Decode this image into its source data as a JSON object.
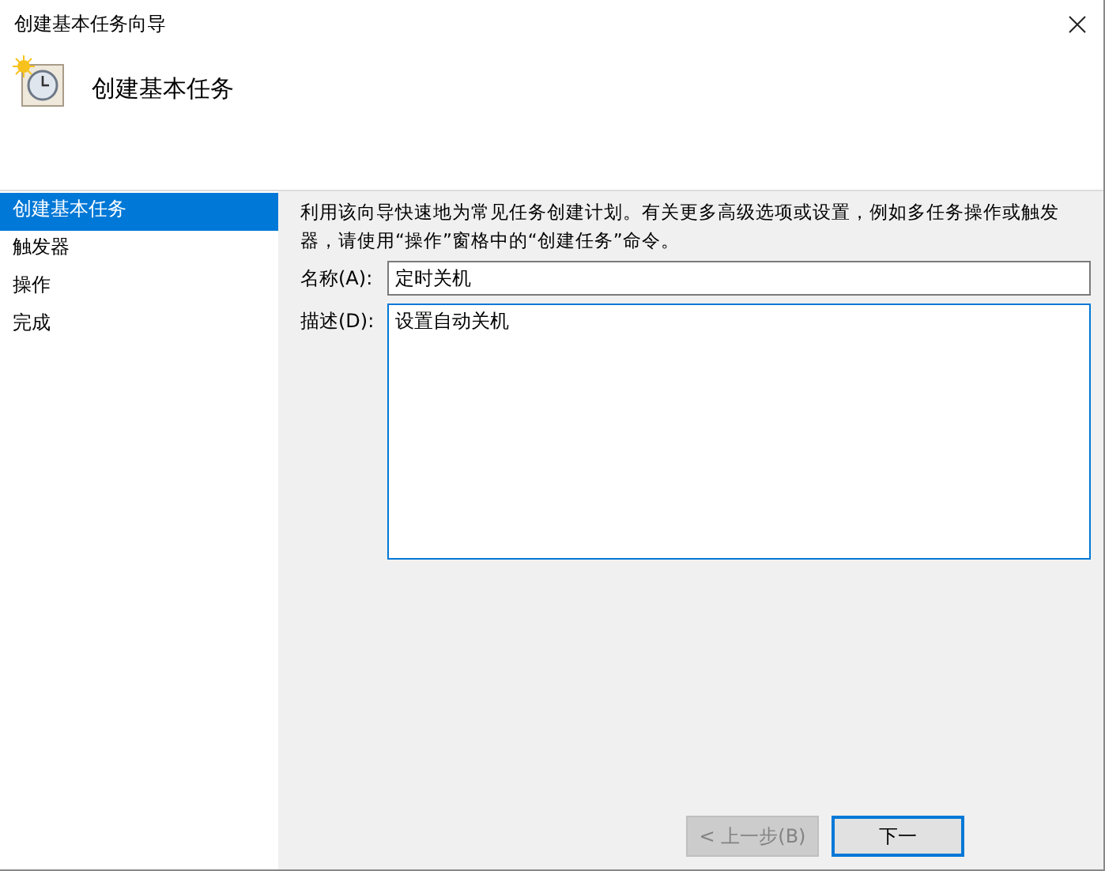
{
  "window": {
    "title": "创建基本任务向导"
  },
  "header": {
    "title": "创建基本任务"
  },
  "sidebar": {
    "items": [
      {
        "label": "创建基本任务",
        "selected": true
      },
      {
        "label": "触发器",
        "selected": false
      },
      {
        "label": "操作",
        "selected": false
      },
      {
        "label": "完成",
        "selected": false
      }
    ]
  },
  "intro": "利用该向导快速地为常见任务创建计划。有关更多高级选项或设置，例如多任务操作或触发器，请使用“操作”窗格中的“创建任务”命令。",
  "fields": [
    {
      "label": "名称(A):",
      "value": "定时关机",
      "kind": "line",
      "focused": false
    },
    {
      "label": "描述(D):",
      "value": "设置自动关机",
      "kind": "area",
      "focused": true
    }
  ],
  "buttons": [
    {
      "label": "< 上一步(B)",
      "disabled": true
    },
    {
      "label": "下一",
      "disabled": false
    }
  ]
}
